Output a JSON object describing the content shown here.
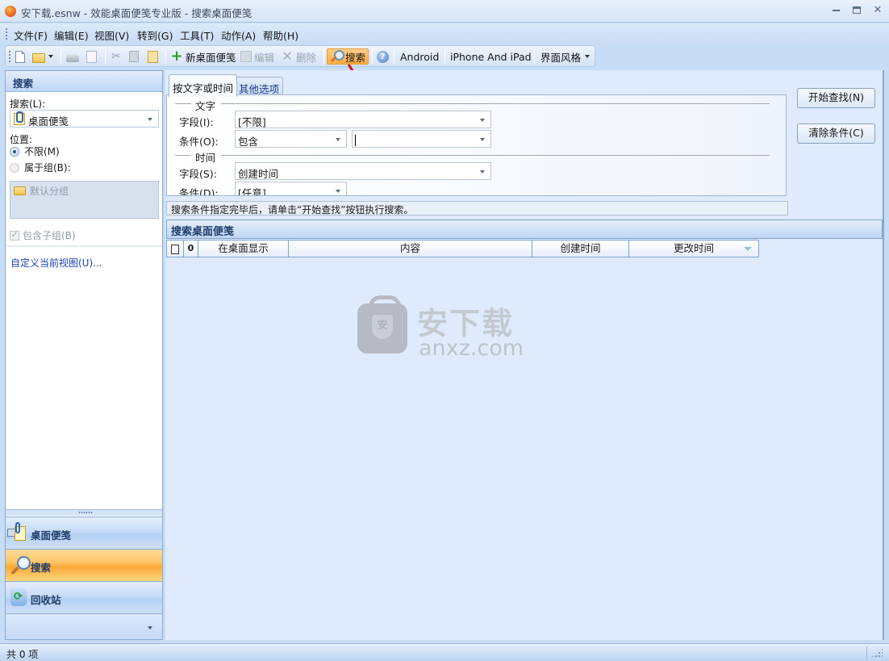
{
  "window": {
    "title": "安下载.esnw - 效能桌面便笺专业版 - 搜索桌面便笺",
    "controls": [
      "minimize",
      "maximize",
      "close"
    ]
  },
  "menubar": {
    "items": [
      "文件(F)",
      "编辑(E)",
      "视图(V)",
      "转到(G)",
      "工具(T)",
      "动作(A)",
      "帮助(H)"
    ]
  },
  "toolbar": {
    "new_doc_icon": "new-document-icon",
    "open_icon": "open-folder-icon",
    "print_icon": "printer-icon",
    "preview_icon": "print-preview-icon",
    "cut_icon": "scissors-icon",
    "copy_icon": "copy-icon",
    "paste_icon": "paste-icon",
    "new_note_label": "新桌面便笺",
    "edit_label": "编辑",
    "delete_label": "删除",
    "search_label": "搜索",
    "help_icon": "help-icon",
    "android_label": "Android",
    "iphone_label": "iPhone And iPad",
    "theme_label": "界面风格"
  },
  "left_pane": {
    "header": "搜索",
    "search_label": "搜索(L):",
    "search_value": "桌面便笺",
    "location_label": "位置:",
    "radio_unlimited": "不限(M)",
    "radio_group": "属于组(B):",
    "radio_selected": "不限(M)",
    "group_item": "默认分组",
    "include_subgroups": "包含子组(B)",
    "include_subgroups_checked": true,
    "customize_link": "自定义当前视图(U)..."
  },
  "nav": {
    "items": [
      {
        "label": "桌面便笺",
        "icon": "note-icon",
        "active": false
      },
      {
        "label": "搜索",
        "icon": "magnifier-icon",
        "active": true
      },
      {
        "label": "回收站",
        "icon": "recycle-bin-icon",
        "active": false
      }
    ]
  },
  "criteria": {
    "tabs": [
      "按文字或时间",
      "其他选项"
    ],
    "active_tab": "按文字或时间",
    "text_section": "文字",
    "text_field_label": "字段(I):",
    "text_field_value": "[不限]",
    "text_cond_label": "条件(O):",
    "text_cond_value": "包含",
    "text_keyword_value": "",
    "time_section": "时间",
    "time_field_label": "字段(S):",
    "time_field_value": "创建时间",
    "time_cond_label": "条件(D):",
    "time_cond_value": "[任意]"
  },
  "buttons": {
    "start_search": "开始查找(N)",
    "clear_conditions": "清除条件(C)"
  },
  "hint": "搜索条件指定完毕后，请单击“开始查找”按钮执行搜索。",
  "results": {
    "header": "搜索桌面便笺",
    "columns": [
      "",
      "",
      "在桌面显示",
      "内容",
      "创建时间",
      "更改时间"
    ],
    "column_icons": [
      "document-icon",
      "attachment-icon"
    ],
    "sorted_column": "更改时间",
    "rows": []
  },
  "watermark": {
    "cn": "安下载",
    "en": "anxz.com",
    "shield_char": "安"
  },
  "status": {
    "text": "共 0 项"
  },
  "colors": {
    "accent_active": "#f9a93a",
    "header_blue": "#1e3d6b",
    "link": "#1c3fb8"
  }
}
